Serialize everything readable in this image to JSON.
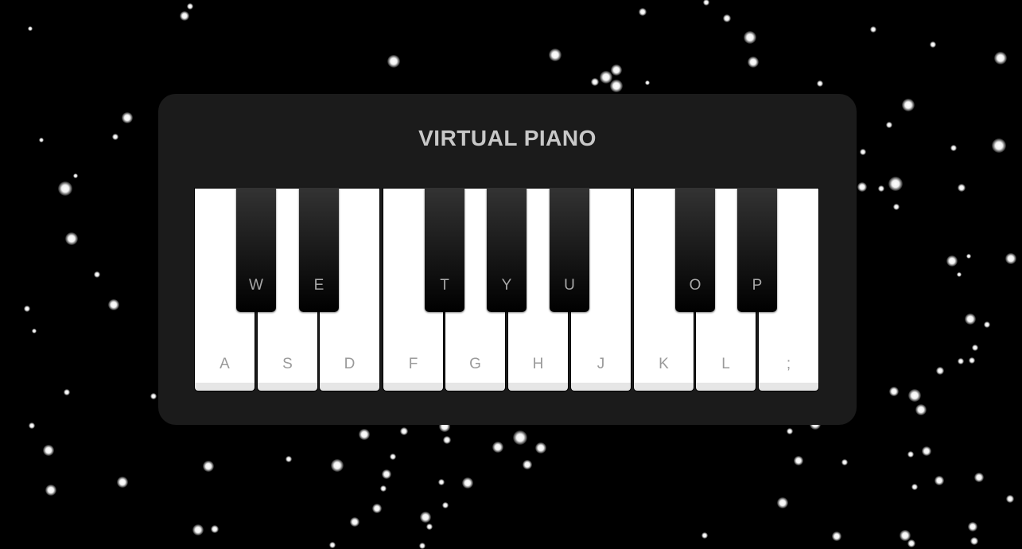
{
  "app": {
    "title": "VIRTUAL PIANO"
  },
  "colors": {
    "background": "#000000",
    "panel": "#1b1b1b",
    "title": "#c8c8c8",
    "white_key": "#ffffff",
    "black_key": "#000000",
    "key_label": "#9a9a9a"
  },
  "piano": {
    "white_keys": [
      "A",
      "S",
      "D",
      "F",
      "G",
      "H",
      "J",
      "K",
      "L",
      ";"
    ],
    "black_keys": [
      "W",
      "E",
      "T",
      "Y",
      "U",
      "O",
      "P"
    ]
  }
}
